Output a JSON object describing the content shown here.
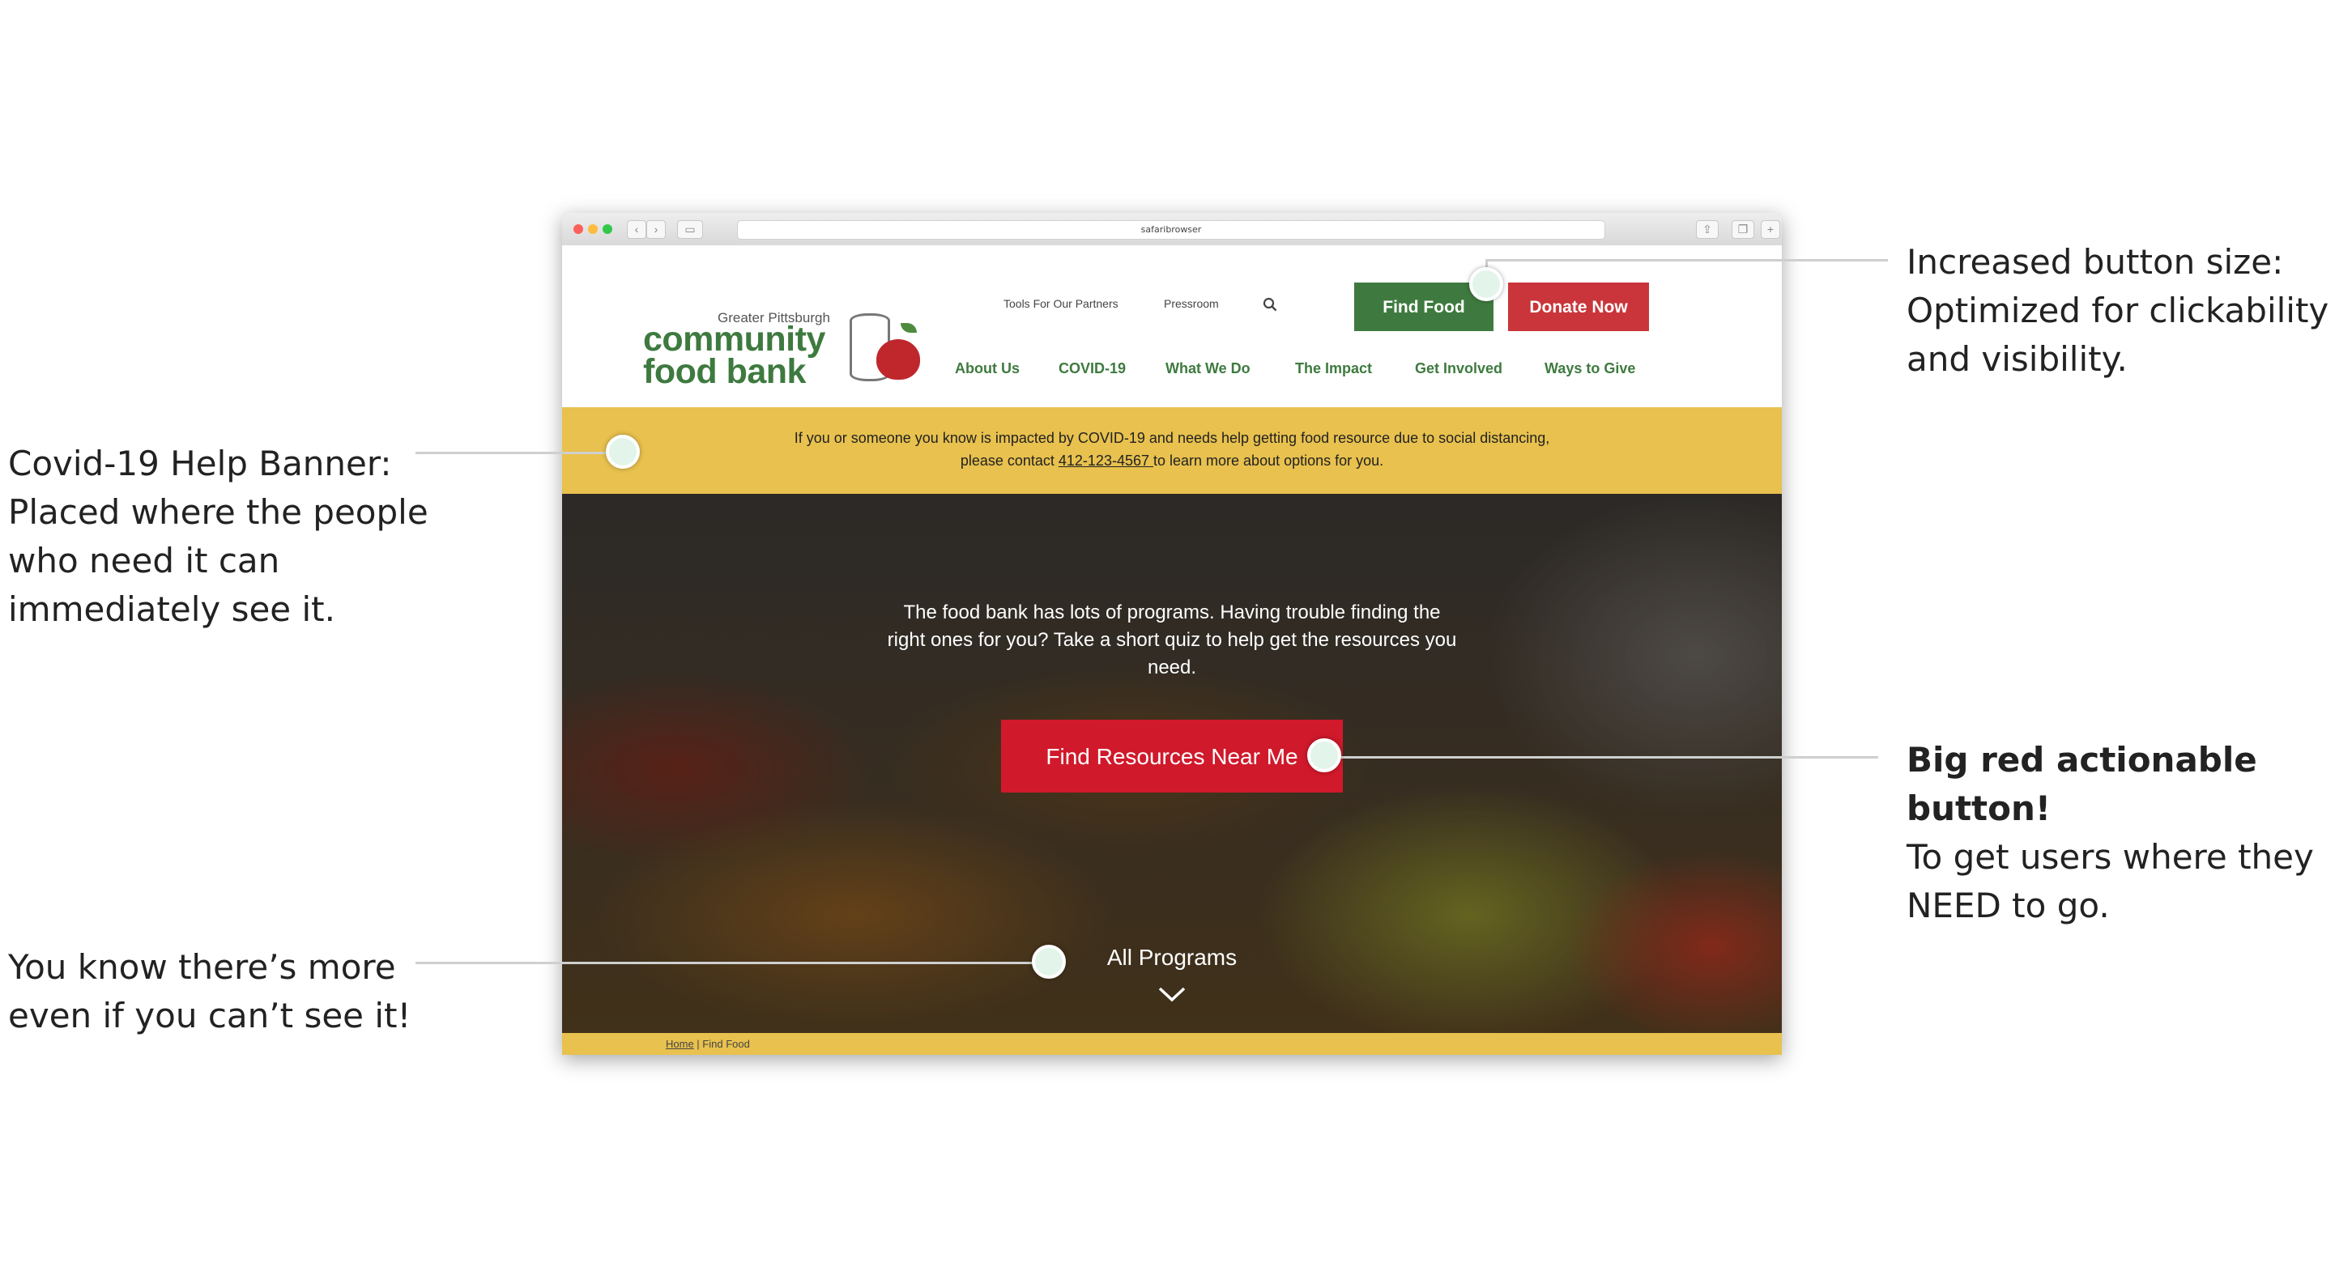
{
  "browser": {
    "url": "safaribrowser"
  },
  "header": {
    "logo": {
      "top": "Greater Pittsburgh",
      "line1": "community",
      "line2": "food bank"
    },
    "utility_links": [
      "Tools For Our Partners",
      "Pressroom"
    ],
    "find_food": "Find Food",
    "donate": "Donate Now",
    "nav": [
      "About Us",
      "COVID-19",
      "What We Do",
      "The Impact",
      "Get Involved",
      "Ways to Give"
    ]
  },
  "covid_banner": {
    "line1": "If you or someone you know is impacted by COVID-19 and needs help getting food resource due to social distancing,",
    "line2_prefix": "please contact ",
    "phone": " 412-123-4567 ",
    "line2_suffix": " to learn more about options for you."
  },
  "hero": {
    "text": "The food bank has lots of programs. Having trouble finding the right ones for you? Take a short quiz to help get the resources you need.",
    "button": "Find Resources Near Me",
    "all_programs": "All Programs"
  },
  "breadcrumb": {
    "home": "Home",
    "separator": " | ",
    "current": "Find Food"
  },
  "annotations": {
    "buttons": {
      "l1": "Increased button size:",
      "l2": "Optimized for clickability",
      "l3": "and visibility."
    },
    "covid": {
      "l1": "Covid-19 Help Banner:",
      "l2": "Placed where the people",
      "l3": "who need it can",
      "l4": "immediately see it."
    },
    "red_button": {
      "l1": "Big red actionable button!",
      "l2": "To get users where they",
      "l3": "NEED to go."
    },
    "more": {
      "l1": "You know there’s more",
      "l2": "even if you can’t see it!"
    }
  }
}
